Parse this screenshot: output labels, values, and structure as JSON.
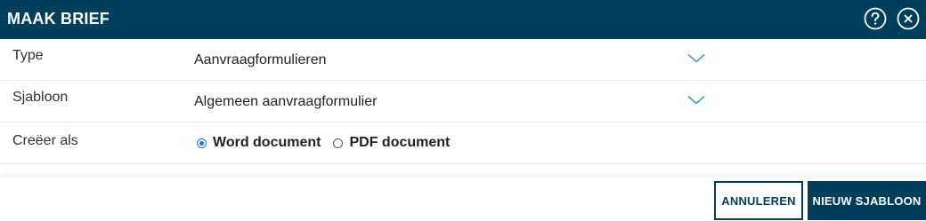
{
  "dialog": {
    "title": "MAAK BRIEF",
    "help_icon": "question-circle-icon",
    "close_icon": "close-circle-icon",
    "header_color": "#003f5c"
  },
  "form": {
    "type": {
      "label": "Type",
      "value": "Aanvraagformulieren",
      "icon": "chevron-down-icon"
    },
    "template": {
      "label": "Sjabloon",
      "value": "Algemeen aanvraagformulier",
      "icon": "chevron-down-icon"
    },
    "create_as": {
      "label": "Creëer als",
      "options": [
        {
          "label": "Word document",
          "selected": true
        },
        {
          "label": "PDF document",
          "selected": false
        }
      ]
    }
  },
  "footer": {
    "cancel_label": "ANNULEREN",
    "new_template_label": "NIEUW SJABLOON"
  },
  "colors": {
    "accent": "#003f5c",
    "chevron": "#3aa0c8",
    "radio_selected": "#1a73e8"
  }
}
